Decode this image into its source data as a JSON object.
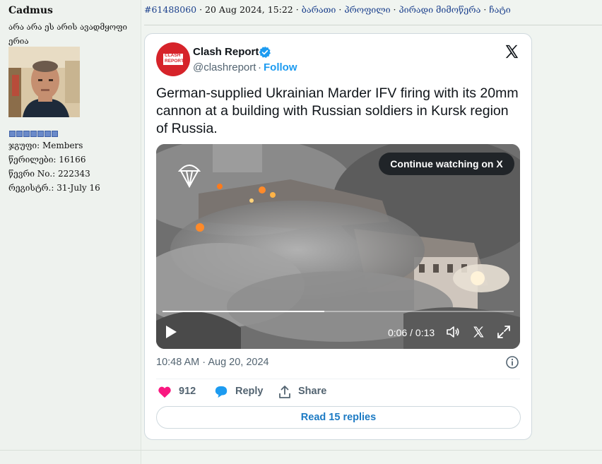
{
  "user": {
    "name": "Cadmus",
    "title": "არა არა ეს არის ავადმყოფი ერია",
    "stats": [
      {
        "label": "ჯგუფი",
        "value": "Members"
      },
      {
        "label": "წერილები",
        "value": "16166"
      },
      {
        "label": "წევრი No.",
        "value": "222343"
      },
      {
        "label": "რეგისტრ.",
        "value": "31-July 16"
      }
    ],
    "rank_pips": 7
  },
  "post": {
    "id": "#61488060",
    "date": "20 Aug 2024, 15:22",
    "links": [
      "ბარათი",
      "პროფილი",
      "პირადი მიმოწერა",
      "ჩატი"
    ]
  },
  "tweet": {
    "account_name": "Clash Report",
    "avatar_text": "CLASH REPORT",
    "handle": "@clashreport",
    "follow": "Follow",
    "text": "German-supplied Ukrainian Marder IFV firing with its 20mm cannon at a building with Russian soldiers in Kursk region of Russia.",
    "video": {
      "continue_label": "Continue watching on X",
      "time": "0:06 / 0:13",
      "progress": 0.46
    },
    "timestamp": "10:48 AM · Aug 20, 2024",
    "likes": "912",
    "reply_label": "Reply",
    "share_label": "Share",
    "read_replies": "Read 15 replies",
    "colors": {
      "accent": "#1d9bf0",
      "like": "#f91880",
      "brand_red": "#d6232a"
    }
  }
}
